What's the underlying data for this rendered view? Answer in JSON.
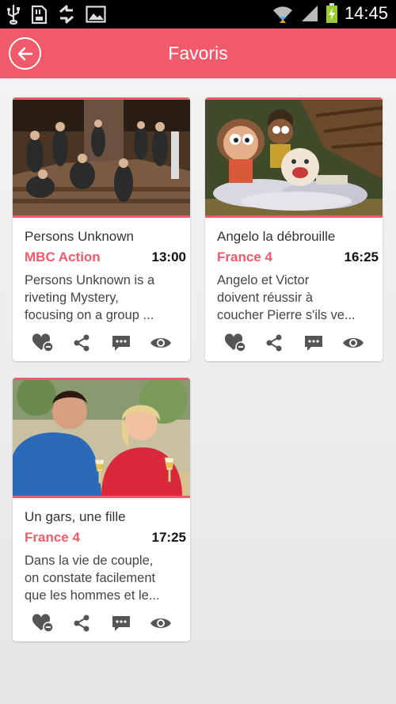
{
  "status_bar": {
    "time": "14:45",
    "left_icons": [
      "usb-icon",
      "sd-card-icon",
      "sync-icon",
      "image-icon"
    ],
    "right_icons": [
      "wifi-icon",
      "signal-icon",
      "battery-charging-icon"
    ]
  },
  "header": {
    "title": "Favoris",
    "back_icon": "back-arrow-icon",
    "accent_color": "#f05a6a"
  },
  "cards": [
    {
      "title": "Persons Unknown",
      "channel": "MBC Action",
      "time": "13:00",
      "desc_lines": [
        "Persons Unknown is a",
        "riveting Mystery,",
        "focusing on a group ..."
      ],
      "thumbnail": "group-on-staircase"
    },
    {
      "title": "Angelo la débrouille",
      "channel": "France 4",
      "time": "16:25",
      "desc_lines": [
        "Angelo et Victor",
        "doivent réussir à",
        "coucher Pierre s'ils ve..."
      ],
      "thumbnail": "cartoon-kids-with-pillows"
    },
    {
      "title": "Un gars, une fille",
      "channel": "France 4",
      "time": "17:25",
      "desc_lines": [
        "Dans la vie de couple,",
        "on constate facilement",
        "que les hommes et le..."
      ],
      "thumbnail": "couple-at-cafe"
    }
  ],
  "actions": [
    "unfavorite-heart-icon",
    "share-icon",
    "comment-icon",
    "view-eye-icon"
  ]
}
